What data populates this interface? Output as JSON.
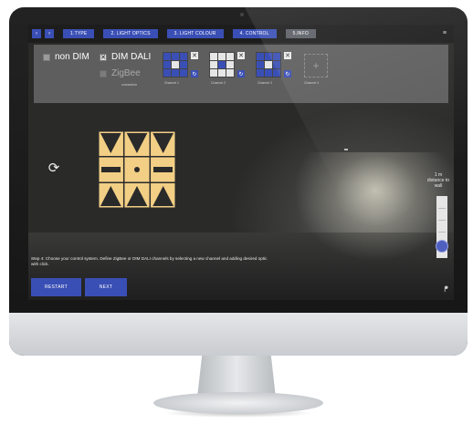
{
  "nav": {
    "back_icon": "chevron-left-icon",
    "forward_icon": "chevron-right-icon",
    "tabs": [
      {
        "label": "1.TYPE",
        "active": false
      },
      {
        "label": "2. LIGHT OPTICS",
        "active": false
      },
      {
        "label": "3. LIGHT COLOUR",
        "active": false
      },
      {
        "label": "4. CONTROL",
        "active": false
      },
      {
        "label": "5.INFO",
        "active": true
      }
    ],
    "menu_icon": "hamburger-menu-icon"
  },
  "control": {
    "non_dim_label": "non DIM",
    "dim_dali_label": "DIM DALI",
    "zigbee_label": "ZigBee",
    "zigbee_caption": "connection",
    "channels": [
      {
        "label": "Channel 1"
      },
      {
        "label": "Channel 2"
      },
      {
        "label": "Channel 3"
      },
      {
        "label": "Channel 4"
      }
    ]
  },
  "distance": {
    "label": "1 m distance to wall"
  },
  "step_text": "Step 4: Choose your control system. Define ZigBee or DIM DALI channels by selecting a new channel and adding desired optic with click.",
  "buttons": {
    "restart": "RESTART",
    "next": "NEXT"
  },
  "colors": {
    "accent": "#3a4fb5",
    "luminaire": "#f2cf85"
  }
}
